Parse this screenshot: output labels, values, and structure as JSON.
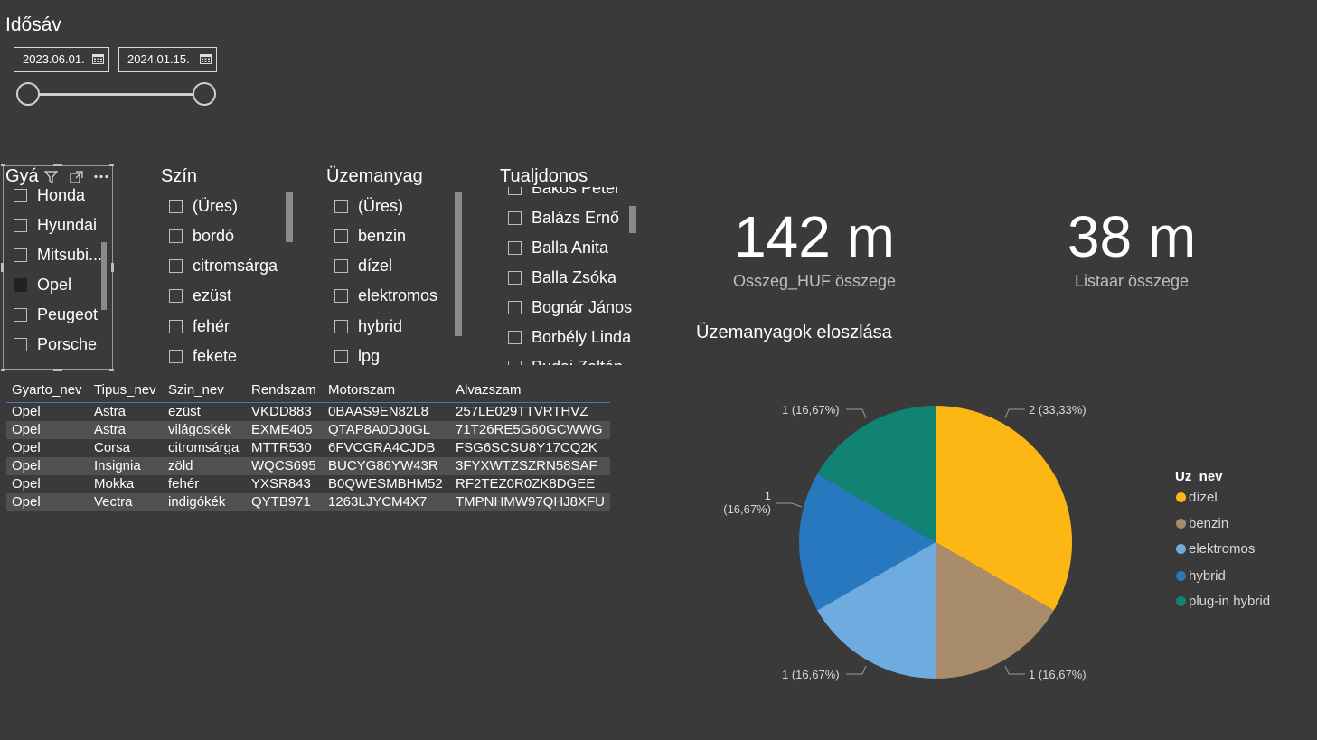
{
  "date_slicer": {
    "title": "Idősáv",
    "start_date": "2023.06.01.",
    "end_date": "2024.01.15."
  },
  "slicers": {
    "gyarto": {
      "title": "Gyá",
      "items": [
        {
          "label": "Honda",
          "checked": false
        },
        {
          "label": "Hyundai",
          "checked": false
        },
        {
          "label": "Mitsubi...",
          "checked": false
        },
        {
          "label": "Opel",
          "checked": true
        },
        {
          "label": "Peugeot",
          "checked": false
        },
        {
          "label": "Porsche",
          "checked": false
        }
      ]
    },
    "szin": {
      "title": "Szín",
      "items": [
        {
          "label": "(Üres)",
          "checked": false
        },
        {
          "label": "bordó",
          "checked": false
        },
        {
          "label": "citromsárga",
          "checked": false
        },
        {
          "label": "ezüst",
          "checked": false
        },
        {
          "label": "fehér",
          "checked": false
        },
        {
          "label": "fekete",
          "checked": false
        }
      ]
    },
    "uzemanyag": {
      "title": "Üzemanyag",
      "items": [
        {
          "label": "(Üres)",
          "checked": false
        },
        {
          "label": "benzin",
          "checked": false
        },
        {
          "label": "dízel",
          "checked": false
        },
        {
          "label": "elektromos",
          "checked": false
        },
        {
          "label": "hybrid",
          "checked": false
        },
        {
          "label": "lpg",
          "checked": false
        }
      ]
    },
    "tulajdonos": {
      "title": "Tualjdonos",
      "items": [
        {
          "label": "Bakos Péter",
          "checked": false
        },
        {
          "label": "Balázs Ernő",
          "checked": false
        },
        {
          "label": "Balla Anita",
          "checked": false
        },
        {
          "label": "Balla Zsóka",
          "checked": false
        },
        {
          "label": "Bognár János",
          "checked": false
        },
        {
          "label": "Borbély Linda",
          "checked": false
        },
        {
          "label": "Budai Zoltán",
          "checked": false
        }
      ]
    }
  },
  "table": {
    "columns": [
      "Gyarto_nev",
      "Tipus_nev",
      "Szin_nev",
      "Rendszam",
      "Motorszam",
      "Alvazszam"
    ],
    "rows": [
      [
        "Opel",
        "Astra",
        "ezüst",
        "VKDD883",
        "0BAAS9EN82L8",
        "257LE029TTVRTHVZ"
      ],
      [
        "Opel",
        "Astra",
        "világoskék",
        "EXME405",
        "QTAP8A0DJ0GL",
        "71T26RE5G60GCWWG"
      ],
      [
        "Opel",
        "Corsa",
        "citromsárga",
        "MTTR530",
        "6FVCGRA4CJDB",
        "FSG6SCSU8Y17CQ2K"
      ],
      [
        "Opel",
        "Insignia",
        "zöld",
        "WQCS695",
        "BUCYG86YW43R",
        "3FYXWTZSZRN58SAF"
      ],
      [
        "Opel",
        "Mokka",
        "fehér",
        "YXSR843",
        "B0QWESMBHM52",
        "RF2TEZ0R0ZK8DGEE"
      ],
      [
        "Opel",
        "Vectra",
        "indigókék",
        "QYTB971",
        "1263LJYCM4X7",
        "TMPNHMW97QHJ8XFU"
      ]
    ]
  },
  "kpi": {
    "osszeg": {
      "value": "142 m",
      "label": "Osszeg_HUF összege"
    },
    "listaar": {
      "value": "38 m",
      "label": "Listaar összege"
    }
  },
  "chart_data": {
    "type": "pie",
    "title": "Üzemanyagok eloszlása",
    "legend_title": "Uz_nev",
    "legend_position": "right",
    "slices": [
      {
        "name": "dízel",
        "value": 2,
        "label": "2 (33,33%)",
        "color": "#FDB714"
      },
      {
        "name": "benzin",
        "value": 1,
        "label": "1 (16,67%)",
        "color": "#A98C6B"
      },
      {
        "name": "elektromos",
        "value": 1,
        "label": "1 (16,67%)",
        "color": "#6EACE0"
      },
      {
        "name": "hybrid",
        "value": 1,
        "label": "1 (16,67%)",
        "color": "#2878C0"
      },
      {
        "name": "plug-in hybrid",
        "value": 1,
        "label": "1 (16,67%)",
        "color": "#118372"
      }
    ]
  },
  "icons": {
    "filter": "filter-icon",
    "focus": "focus-mode-icon",
    "more": "more-options-icon",
    "calendar": "calendar-icon"
  }
}
